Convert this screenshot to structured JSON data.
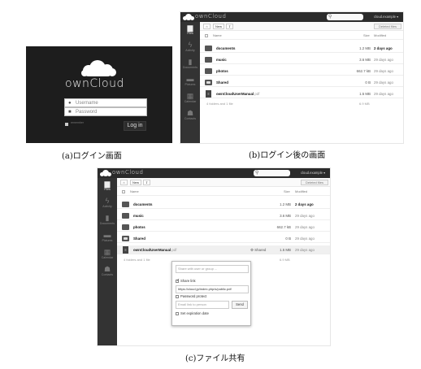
{
  "brand": "ownCloud",
  "login": {
    "username_placeholder": "Username",
    "password_placeholder": "Password",
    "remember_label": "remember",
    "login_button": "Log in"
  },
  "header": {
    "search_icon": "search-icon",
    "user_b": "cloud.example ▾",
    "user_c": "cloud.example ▾"
  },
  "sidebar": [
    {
      "label": "Files",
      "icon": "folder-icon"
    },
    {
      "label": "Activity",
      "icon": "bolt-icon"
    },
    {
      "label": "Documents",
      "icon": "document-icon"
    },
    {
      "label": "Pictures",
      "icon": "image-icon"
    },
    {
      "label": "Calendar",
      "icon": "calendar-icon"
    },
    {
      "label": "Contacts",
      "icon": "contacts-icon"
    }
  ],
  "controls": {
    "new_label": "New",
    "upload_icon": "upload-icon",
    "home_icon": "home-icon",
    "deleted_files_label": "Deleted files"
  },
  "table": {
    "name_header": "Name",
    "size_header": "Size",
    "modified_header": "Modified"
  },
  "files": [
    {
      "name": "documents",
      "ext": "",
      "type": "folder",
      "size": "1.2 MB",
      "modified": "2 days ago",
      "recent": true
    },
    {
      "name": "music",
      "ext": "",
      "type": "folder",
      "size": "3.6 MB",
      "modified": "29 days ago",
      "recent": false
    },
    {
      "name": "photos",
      "ext": "",
      "type": "folder",
      "size": "662.7 kB",
      "modified": "29 days ago",
      "recent": false
    },
    {
      "name": "Shared",
      "ext": "",
      "type": "shared-folder",
      "size": "0 B",
      "modified": "29 days ago",
      "recent": false
    },
    {
      "name": "ownCloudUserManual",
      "ext": ".pdf",
      "type": "pdf",
      "size": "1.5 MB",
      "modified": "29 days ago",
      "recent": false
    }
  ],
  "summary": {
    "text": "4 folders and 1 file",
    "total": "6.9 MB"
  },
  "share": {
    "shared_label": "Shared",
    "share_with_placeholder": "Share with user or group ...",
    "share_link_label": "Share link",
    "link_url": "https://cloud.jp/index.php/s/public.pdf",
    "password_protect_label": "Password protect",
    "email_placeholder": "Email link to person",
    "send_button": "Send",
    "expiration_label": "Set expiration date"
  },
  "captions": {
    "a": "(a)ログイン画面",
    "b": "(b)ログイン後の画面",
    "c": "(c)ファイル共有"
  }
}
